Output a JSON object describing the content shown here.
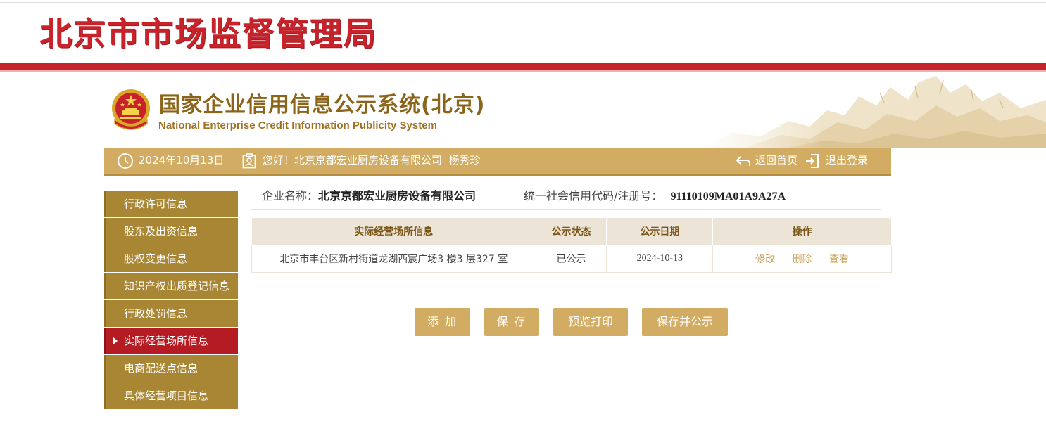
{
  "agency": {
    "name": "北京市市场监督管理局"
  },
  "system": {
    "title": "国家企业信用信息公示系统(北京)",
    "subtitle": "National Enterprise Credit Information Publicity System"
  },
  "info_bar": {
    "date": "2024年10月13日",
    "greeting": "您好！北京京都宏业厨房设备有限公司  杨秀珍",
    "home_link": "返回首页",
    "logout_link": "退出登录"
  },
  "sidebar": {
    "items": [
      {
        "label": "行政许可信息",
        "active": false
      },
      {
        "label": "股东及出资信息",
        "active": false
      },
      {
        "label": "股权变更信息",
        "active": false
      },
      {
        "label": "知识产权出质登记信息",
        "active": false
      },
      {
        "label": "行政处罚信息",
        "active": false
      },
      {
        "label": "实际经营场所信息",
        "active": true
      },
      {
        "label": "电商配送点信息",
        "active": false
      },
      {
        "label": "具体经营项目信息",
        "active": false
      }
    ]
  },
  "company": {
    "name_label": "企业名称：",
    "name": "北京京都宏业厨房设备有限公司",
    "code_label": "统一社会信用代码/注册号：",
    "code": "91110109MA01A9A27A"
  },
  "table": {
    "headers": [
      "实际经营场所信息",
      "公示状态",
      "公示日期",
      "操作"
    ],
    "rows": [
      {
        "address": "北京市丰台区新村街道龙湖西宸广场3 楼3 层327 室",
        "status": "已公示",
        "date": "2024-10-13",
        "actions": [
          "修改",
          "删除",
          "查看"
        ]
      }
    ]
  },
  "buttons": {
    "add": "添 加",
    "save": "保 存",
    "preview": "预览打印",
    "save_publish": "保存并公示"
  },
  "colors": {
    "brand_red": "#c8232b",
    "gold": "#d1ac62",
    "sidebar_gold": "#a98634",
    "active_red": "#b41b22",
    "title_brown": "#8b6419"
  }
}
